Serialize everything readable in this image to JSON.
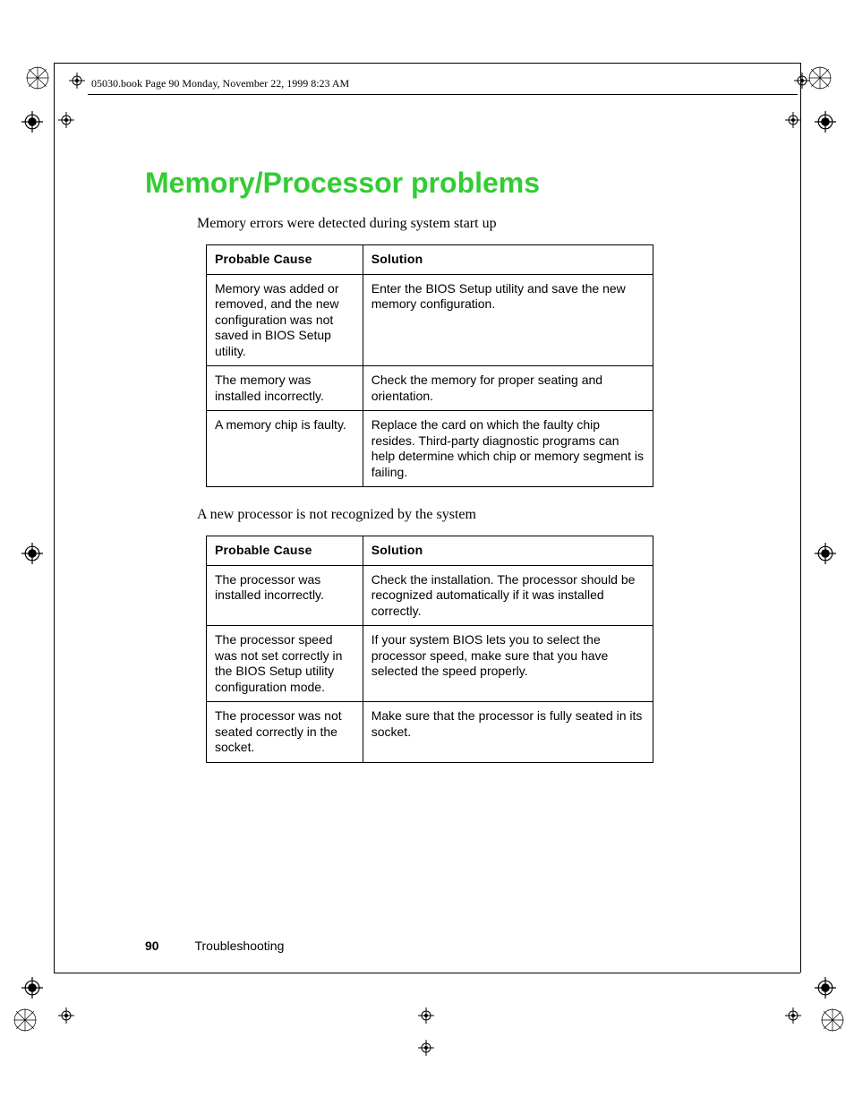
{
  "header_line": "05030.book  Page 90  Monday, November 22, 1999  8:23 AM",
  "title": "Memory/Processor problems",
  "section1": {
    "intro": "Memory errors were detected during system start up",
    "headers": {
      "cause": "Probable Cause",
      "solution": "Solution"
    },
    "rows": [
      {
        "cause": "Memory was added or removed, and the new configuration was not saved in BIOS Setup utility.",
        "solution": "Enter the BIOS Setup utility and save the new memory configuration."
      },
      {
        "cause": "The memory was installed incorrectly.",
        "solution": "Check the memory for proper seating and orientation."
      },
      {
        "cause": "A memory chip is faulty.",
        "solution": "Replace the card on which the faulty chip resides. Third-party diagnostic programs can help determine which chip or memory segment is failing."
      }
    ]
  },
  "section2": {
    "intro": "A new processor is not recognized by the system",
    "headers": {
      "cause": "Probable Cause",
      "solution": "Solution"
    },
    "rows": [
      {
        "cause": "The processor was installed incorrectly.",
        "solution": "Check the installation. The processor should be recognized automatically if it was installed correctly."
      },
      {
        "cause": "The processor speed was not set correctly in the BIOS Setup utility configuration mode.",
        "solution": "If your system BIOS lets you to select the processor speed, make sure that you have selected the speed properly."
      },
      {
        "cause": "The processor was not seated correctly in the socket.",
        "solution": "Make sure that the processor is fully seated in its socket."
      }
    ]
  },
  "footer": {
    "page_number": "90",
    "section": "Troubleshooting"
  }
}
